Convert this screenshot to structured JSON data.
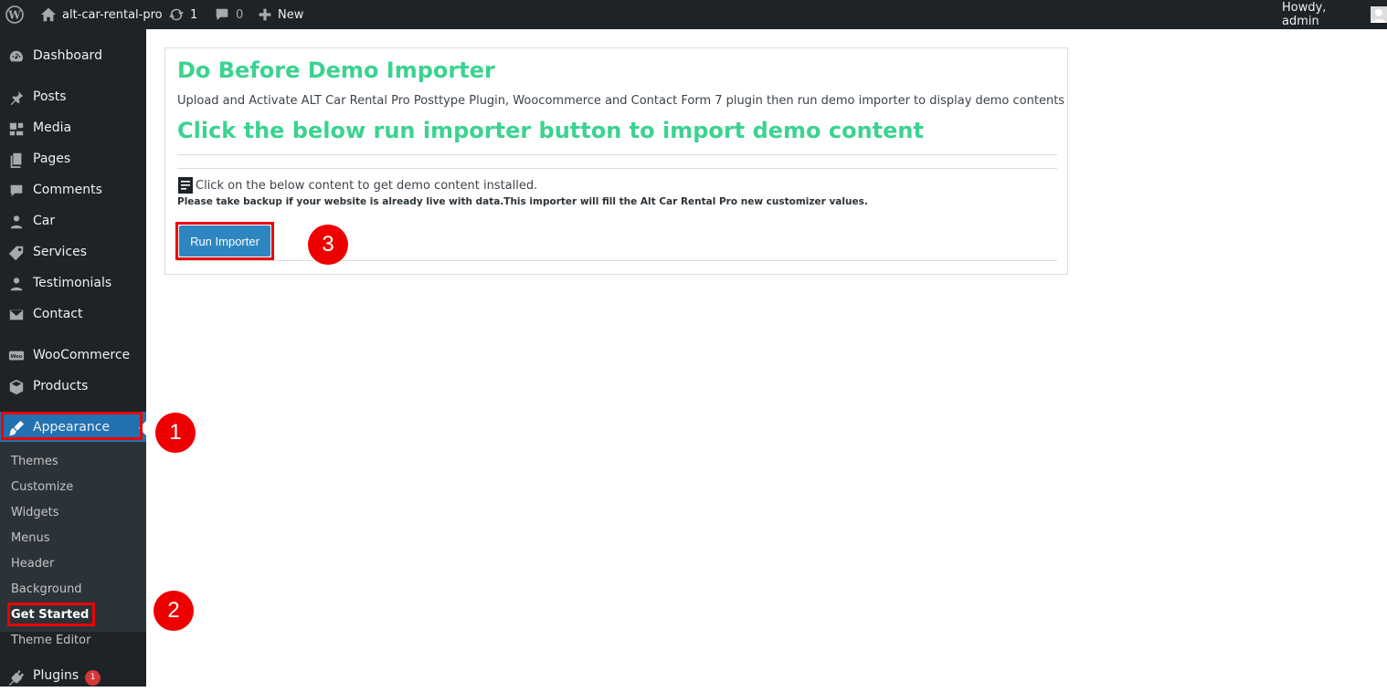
{
  "adminbar": {
    "site_name": "alt-car-rental-pro",
    "updates_count": "1",
    "comments_count": "0",
    "new_label": "New",
    "howdy": "Howdy, admin"
  },
  "sidebar": {
    "items": [
      {
        "label": "Dashboard",
        "icon": "dashboard-icon"
      },
      {
        "label": "Posts",
        "icon": "pin-icon"
      },
      {
        "label": "Media",
        "icon": "media-icon"
      },
      {
        "label": "Pages",
        "icon": "pages-icon"
      },
      {
        "label": "Comments",
        "icon": "comment-icon"
      },
      {
        "label": "Car",
        "icon": "users-icon"
      },
      {
        "label": "Services",
        "icon": "tag-icon"
      },
      {
        "label": "Testimonials",
        "icon": "users-icon"
      },
      {
        "label": "Contact",
        "icon": "email-icon"
      },
      {
        "label": "WooCommerce",
        "icon": "woocommerce-icon"
      },
      {
        "label": "Products",
        "icon": "box-icon"
      },
      {
        "label": "Appearance",
        "icon": "brush-icon"
      },
      {
        "label": "Plugins",
        "icon": "plugin-icon",
        "badge": "1"
      }
    ],
    "submenu": [
      "Themes",
      "Customize",
      "Widgets",
      "Menus",
      "Header",
      "Background",
      "Get Started",
      "Theme Editor"
    ]
  },
  "card": {
    "title": "Do Before Demo Importer",
    "description": "Upload and Activate ALT Car Rental Pro Posttype Plugin, Woocommerce and Contact Form 7 plugin then run demo importer to display demo contents",
    "subtitle": "Click the below run importer button to import demo content",
    "instruction": "Click on the below content to get demo content installed.",
    "warning": "Please take backup if your website is already live with data.This importer will fill the Alt Car Rental Pro new customizer values.",
    "button_label": "Run Importer"
  },
  "annotations": [
    "1",
    "2",
    "3"
  ],
  "colors": {
    "accent": "#2271b1",
    "heading_green": "#3bd38f",
    "highlight": "#ee0000"
  }
}
